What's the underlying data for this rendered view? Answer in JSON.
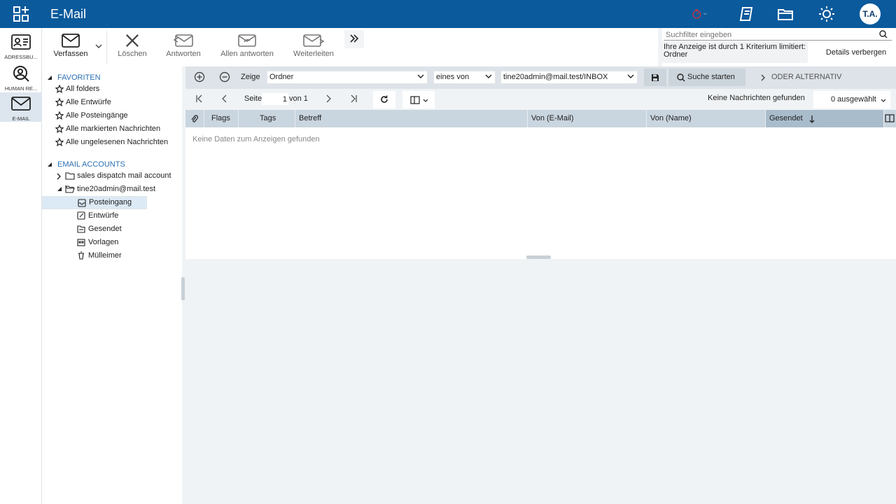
{
  "app": {
    "title": "E-Mail",
    "user_initials": "T.A."
  },
  "appbar": [
    {
      "label": "ADRESSBU..."
    },
    {
      "label": "HUMAN RE..."
    },
    {
      "label": "E-MAIL"
    }
  ],
  "toolbar": {
    "compose": "Verfassen",
    "delete": "Löschen",
    "reply": "Antworten",
    "reply_all": "Allen antworten",
    "forward": "Weiterleiten"
  },
  "search": {
    "placeholder": "Suchfilter eingeben",
    "criteria_line1": "Ihre Anzeige ist durch 1 Kriterium limitiert:",
    "criteria_line2": "Ordner",
    "hide_details": "Details verbergen"
  },
  "tree": {
    "favorites_header": "FAVORITEN",
    "favorites": [
      "All folders",
      "Alle Entwürfe",
      "Alle Posteingänge",
      "Alle markierten Nachrichten",
      "Alle ungelesenen Nachrichten"
    ],
    "accounts_header": "EMAIL ACCOUNTS",
    "accounts": [
      "sales dispatch mail account",
      "tine20admin@mail.test"
    ],
    "folders": [
      "Posteingang",
      "Entwürfe",
      "Gesendet",
      "Vorlagen",
      "Mülleimer"
    ]
  },
  "filter": {
    "show_label": "Zeige",
    "field": "Ordner",
    "operator": "eines von",
    "value": "tine20admin@mail.test/INBOX",
    "start_search": "Suche starten",
    "or_alternative": "ODER ALTERNATIV"
  },
  "paging": {
    "page_label": "Seite",
    "page": "1",
    "of_label": "von 1",
    "no_messages": "Keine Nachrichten gefunden",
    "selected": "0 ausgewählt"
  },
  "grid": {
    "columns": [
      "Flags",
      "Tags",
      "Betreff",
      "Von (E-Mail)",
      "Von (Name)",
      "Gesendet"
    ],
    "empty": "Keine Daten zum Anzeigen gefunden"
  }
}
